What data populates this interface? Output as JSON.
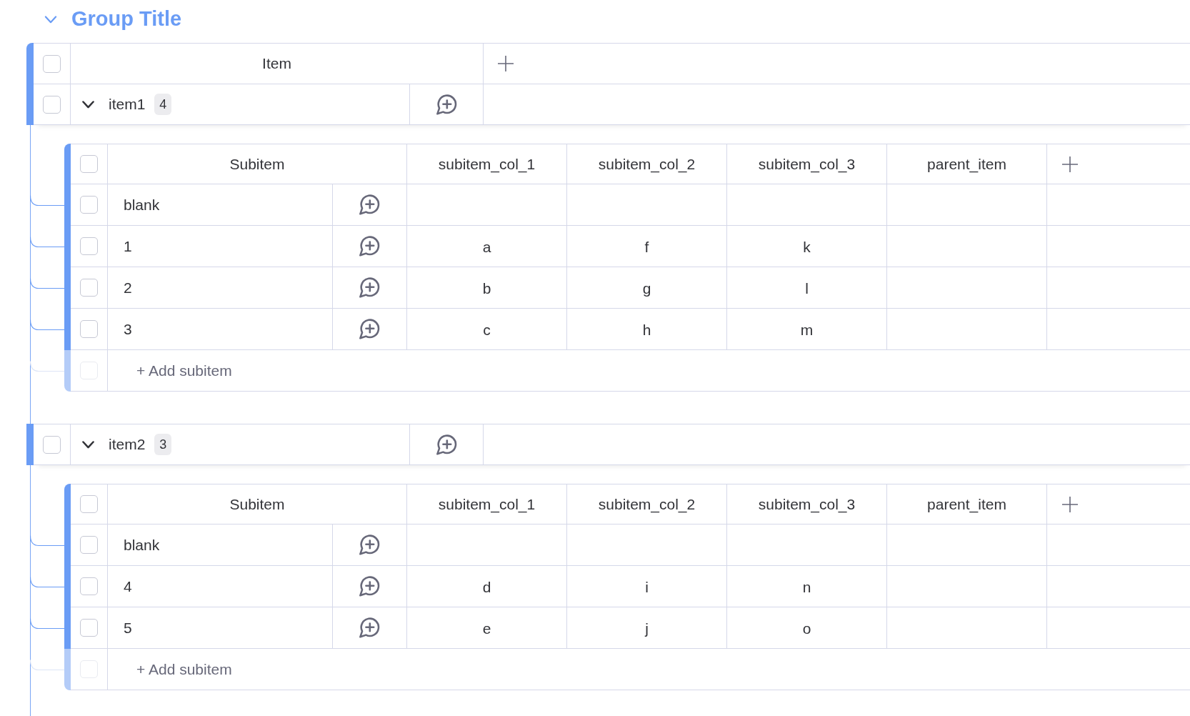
{
  "group": {
    "title": "Group Title",
    "expanded": true
  },
  "header": {
    "checked": false,
    "columns": [
      "Item"
    ]
  },
  "items": [
    {
      "name": "item1",
      "count": "4",
      "checked": false,
      "expanded": true,
      "subitems": {
        "header_checked": false,
        "columns": [
          "Subitem",
          "subitem_col_1",
          "subitem_col_2",
          "subitem_col_3",
          "parent_item"
        ],
        "rows": [
          {
            "name": "blank",
            "checked": false
          },
          {
            "name": "1",
            "checked": false,
            "values": [
              "a",
              "f",
              "k"
            ]
          },
          {
            "name": "2",
            "checked": false,
            "values": [
              "b",
              "g",
              "l"
            ]
          },
          {
            "name": "3",
            "checked": false,
            "values": [
              "c",
              "h",
              "m"
            ]
          }
        ],
        "add_row": {
          "label": "+ Add subitem",
          "checked": false,
          "disabled": true
        }
      }
    },
    {
      "name": "item2",
      "count": "3",
      "checked": false,
      "expanded": true,
      "subitems": {
        "header_checked": false,
        "columns": [
          "Subitem",
          "subitem_col_1",
          "subitem_col_2",
          "subitem_col_3",
          "parent_item"
        ],
        "rows": [
          {
            "name": "blank",
            "checked": false
          },
          {
            "name": "4",
            "checked": false,
            "values": [
              "d",
              "i",
              "n"
            ]
          },
          {
            "name": "5",
            "checked": false,
            "values": [
              "e",
              "j",
              "o"
            ]
          }
        ],
        "add_row": {
          "label": "+ Add subitem",
          "checked": false,
          "disabled": true
        }
      }
    }
  ]
}
